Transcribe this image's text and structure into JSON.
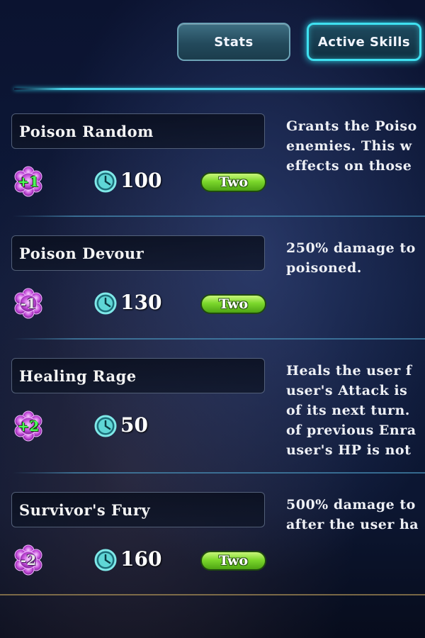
{
  "tabs": {
    "stats_label": "Stats",
    "active_skills_label": "Active Skills"
  },
  "skills": [
    {
      "name": "Poison Random",
      "modifier": "+1",
      "cooldown": "100",
      "target": "Two",
      "description": "Grants the Poiso\nenemies. This w\neffects on those"
    },
    {
      "name": "Poison Devour",
      "modifier": "-1",
      "cooldown": "130",
      "target": "Two",
      "description": "250% damage to\npoisoned."
    },
    {
      "name": "Healing Rage",
      "modifier": "+2",
      "cooldown": "50",
      "target": "",
      "description": "Heals the user f\nuser's Attack is\nof its next turn.\nof previous Enra\nuser's HP is not"
    },
    {
      "name": "Survivor's Fury",
      "modifier": "-2",
      "cooldown": "160",
      "target": "Two",
      "description": "500% damage to\nafter the user ha"
    }
  ],
  "colors": {
    "accent_cyan": "#3fe0f0",
    "positive_modifier": "#4cff5a",
    "gem_purple": "#c24ad8",
    "target_pill_green": "#7cd82c"
  },
  "icons": {
    "modifier": "purple-flower-gem-icon",
    "cooldown": "clock-icon"
  }
}
